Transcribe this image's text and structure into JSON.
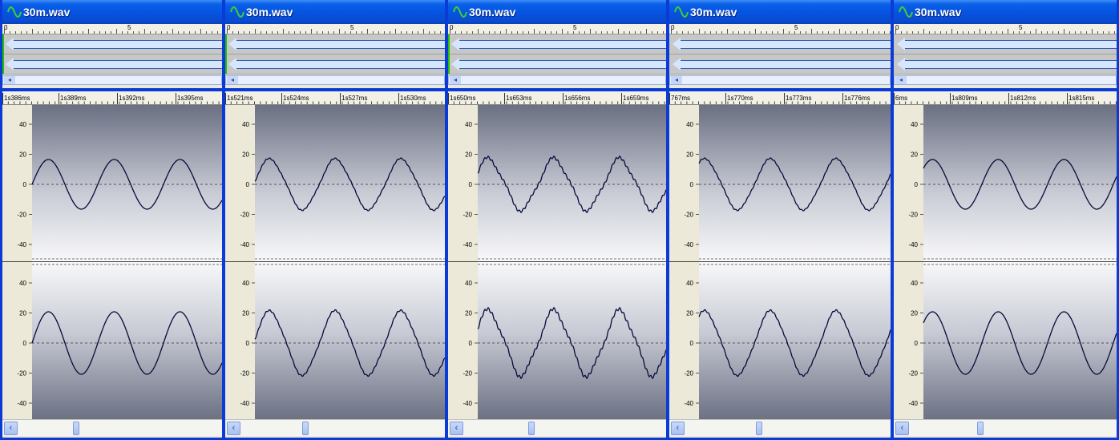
{
  "windows": [
    {
      "title": "30m.wav",
      "overview_ticks": [
        "0",
        "5"
      ],
      "time_labels": [
        "1s386ms",
        "1s389ms",
        "1s392ms",
        "1s395ms"
      ],
      "y_labels": [
        "40",
        "20",
        "0",
        "-20",
        "-40"
      ],
      "phase": 0.0,
      "distortion": 0
    },
    {
      "title": "30m.wav",
      "overview_ticks": [
        "0",
        "5"
      ],
      "time_labels": [
        "1s521ms",
        "1s524ms",
        "1s527ms",
        "1s530ms"
      ],
      "y_labels": [
        "40",
        "20",
        "0",
        "-20",
        "-40"
      ],
      "phase": 0.15,
      "distortion": 1
    },
    {
      "title": "30m.wav",
      "overview_ticks": [
        "0",
        "5"
      ],
      "time_labels": [
        "1s650ms",
        "1s653ms",
        "1s656ms",
        "1s659ms"
      ],
      "y_labels": [
        "40",
        "20",
        "0",
        "-20",
        "-40"
      ],
      "phase": 0.55,
      "distortion": 2
    },
    {
      "title": "30m.wav",
      "overview_ticks": [
        "0",
        "5"
      ],
      "time_labels": [
        "767ms",
        "1s770ms",
        "1s773ms",
        "1s776ms"
      ],
      "y_labels": [
        "40",
        "20",
        "0",
        "-20",
        "-40"
      ],
      "phase": 1.0,
      "distortion": 1
    },
    {
      "title": "30m.wav",
      "overview_ticks": [
        "0",
        "5"
      ],
      "time_labels": [
        "6ms",
        "1s809ms",
        "1s812ms",
        "1s815ms"
      ],
      "y_labels": [
        "40",
        "20",
        "0",
        "-20",
        "-40"
      ],
      "phase": 0.7,
      "distortion": 0
    }
  ]
}
